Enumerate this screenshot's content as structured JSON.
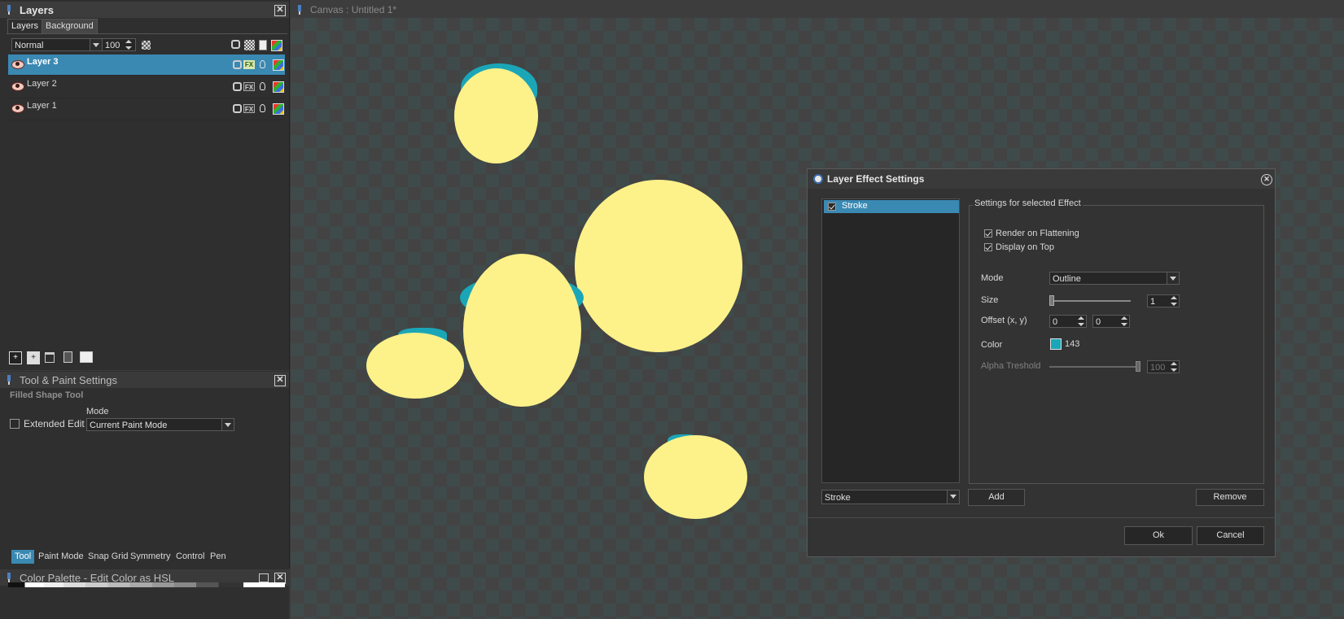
{
  "layers_panel": {
    "title": "Layers",
    "tabs": [
      "Layers",
      "Background"
    ],
    "blend_mode": "Normal",
    "opacity": "100",
    "layers": [
      {
        "name": "Layer 3",
        "selected": true
      },
      {
        "name": "Layer 2",
        "selected": false
      },
      {
        "name": "Layer 1",
        "selected": false
      }
    ],
    "footer_icons": [
      "add-layer-icon",
      "duplicate-layer-icon",
      "delete-layer-icon",
      "merge-layer-icon",
      "layer-properties-icon"
    ]
  },
  "tool_panel": {
    "title": "Tool & Paint Settings",
    "tool_name": "Filled Shape Tool",
    "mode_label": "Mode",
    "extended_edit_label": "Extended Edit",
    "mode_value": "Current Paint Mode",
    "bottom_tabs": [
      "Tool",
      "Paint Mode",
      "Snap Grid",
      "Symmetry",
      "Control",
      "Pen"
    ]
  },
  "color_palette": {
    "title": "Color Palette - Edit Color as HSL"
  },
  "canvas": {
    "title": "Canvas : Untitled 1*",
    "checker_colors": [
      "#3f4a4a",
      "#434343"
    ],
    "fill_color": "#fdf18a",
    "stroke_color": "#1ba6b8"
  },
  "dialog": {
    "title": "Layer Effect Settings",
    "effects": [
      {
        "name": "Stroke",
        "checked": true
      }
    ],
    "group_title": "Settings for selected Effect",
    "render_on_flattening_label": "Render on Flattening",
    "display_on_top_label": "Display on Top",
    "mode_label": "Mode",
    "mode_value": "Outline",
    "size_label": "Size",
    "size_value": "1",
    "offset_label": "Offset (x, y)",
    "offset_x": "0",
    "offset_y": "0",
    "color_label": "Color",
    "color_value": "143",
    "color_swatch": "#1ba6b8",
    "alpha_label": "Alpha Treshold",
    "alpha_value": "100",
    "effect_select": "Stroke",
    "add_label": "Add",
    "remove_label": "Remove",
    "ok_label": "Ok",
    "cancel_label": "Cancel"
  }
}
